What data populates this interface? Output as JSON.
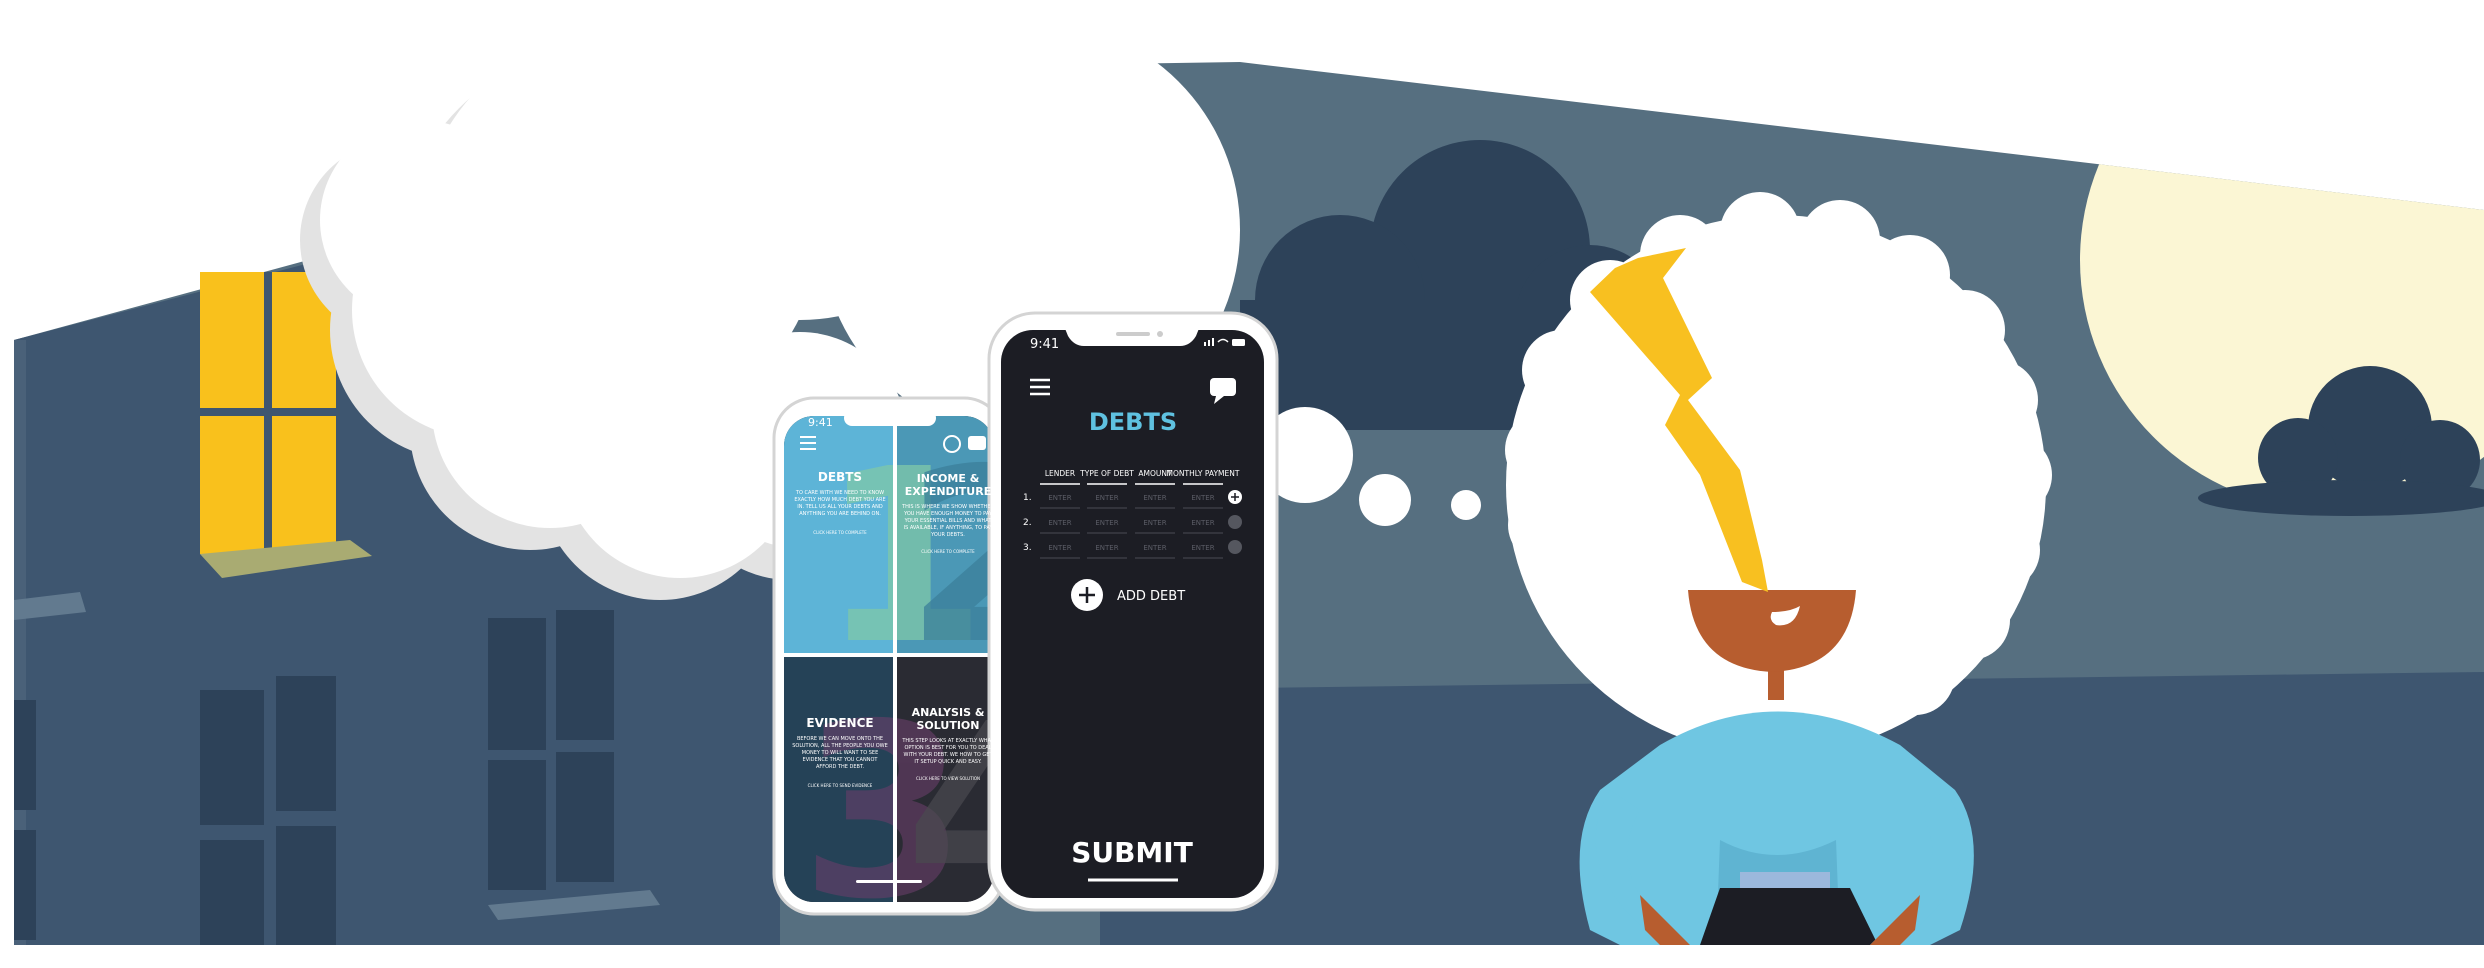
{
  "colors": {
    "sky": "#566f80",
    "wall": "#3e5670",
    "window_lit": "#f9c11c",
    "cloud_dark": "#2d4259",
    "sun": "#fbf6d4",
    "phone_dark": "#1c1d24",
    "accent_blue": "#5fc1e0",
    "skin": "#b75d2f",
    "shirt": "#6fc6e2",
    "bolt": "#f8c020"
  },
  "phone_left": {
    "time": "9:41",
    "tiles": [
      {
        "title": "DEBTS",
        "body": "TO CARE WITH WE NEED TO KNOW EXACTLY HOW MUCH DEBT YOU ARE IN. TELL US ALL YOUR DEBTS AND ANYTHING YOU ARE BEHIND ON.",
        "cta": "CLICK HERE TO COMPLETE",
        "numeral": "1"
      },
      {
        "title": "INCOME & EXPENDITURE",
        "body": "THIS IS WHERE WE SHOW WHETHER YOU HAVE ENOUGH MONEY TO PAY YOUR ESSENTIAL BILLS AND WHAT IS AVAILABLE, IF ANYTHING, TO PAY YOUR DEBTS.",
        "cta": "CLICK HERE TO COMPLETE",
        "numeral": "2"
      },
      {
        "title": "EVIDENCE",
        "body": "BEFORE WE CAN MOVE ONTO THE SOLUTION, ALL THE PEOPLE YOU OWE MONEY TO WILL WANT TO SEE EVIDENCE THAT YOU CANNOT AFFORD THE DEBT.",
        "cta": "CLICK HERE TO SEND EVIDENCE",
        "numeral": "3"
      },
      {
        "title": "ANALYSIS & SOLUTION",
        "body": "THIS STEP LOOKS AT EXACTLY WHAT OPTION IS BEST FOR YOU TO DEAL WITH YOUR DEBT. WE HOW TO GET IT SETUP QUICK AND EASY.",
        "cta": "CLICK HERE TO VIEW SOLUTION",
        "numeral": "4"
      }
    ]
  },
  "phone_right": {
    "time": "9:41",
    "title": "DEBTS",
    "columns": [
      "LENDER",
      "TYPE OF DEBT",
      "AMOUNT",
      "MONTHLY PAYMENT"
    ],
    "rows": [
      {
        "num": "1.",
        "cells": [
          "ENTER",
          "ENTER",
          "ENTER",
          "ENTER"
        ]
      },
      {
        "num": "2.",
        "cells": [
          "ENTER",
          "ENTER",
          "ENTER",
          "ENTER"
        ]
      },
      {
        "num": "3.",
        "cells": [
          "ENTER",
          "ENTER",
          "ENTER",
          "ENTER"
        ]
      }
    ],
    "add_label": "ADD DEBT",
    "submit_label": "SUBMIT"
  }
}
